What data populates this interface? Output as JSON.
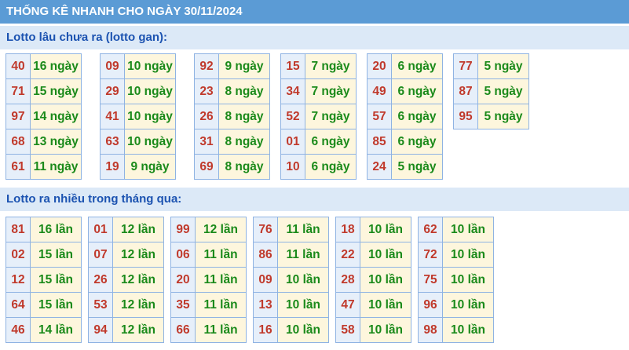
{
  "title": "THỐNG KÊ NHANH CHO NGÀY 30/11/2024",
  "gan": {
    "heading": "Lotto lâu chưa ra (lotto gan):",
    "columns": [
      [
        {
          "num": "40",
          "count": "16 ngày"
        },
        {
          "num": "71",
          "count": "15 ngày"
        },
        {
          "num": "97",
          "count": "14 ngày"
        },
        {
          "num": "68",
          "count": "13 ngày"
        },
        {
          "num": "61",
          "count": "11 ngày"
        }
      ],
      [
        {
          "num": "09",
          "count": "10 ngày"
        },
        {
          "num": "29",
          "count": "10 ngày"
        },
        {
          "num": "41",
          "count": "10 ngày"
        },
        {
          "num": "63",
          "count": "10 ngày"
        },
        {
          "num": "19",
          "count": "9 ngày"
        }
      ],
      [
        {
          "num": "92",
          "count": "9 ngày"
        },
        {
          "num": "23",
          "count": "8 ngày"
        },
        {
          "num": "26",
          "count": "8 ngày"
        },
        {
          "num": "31",
          "count": "8 ngày"
        },
        {
          "num": "69",
          "count": "8 ngày"
        }
      ],
      [
        {
          "num": "15",
          "count": "7 ngày"
        },
        {
          "num": "34",
          "count": "7 ngày"
        },
        {
          "num": "52",
          "count": "7 ngày"
        },
        {
          "num": "01",
          "count": "6 ngày"
        },
        {
          "num": "10",
          "count": "6 ngày"
        }
      ],
      [
        {
          "num": "20",
          "count": "6 ngày"
        },
        {
          "num": "49",
          "count": "6 ngày"
        },
        {
          "num": "57",
          "count": "6 ngày"
        },
        {
          "num": "85",
          "count": "6 ngày"
        },
        {
          "num": "24",
          "count": "5 ngày"
        }
      ],
      [
        {
          "num": "77",
          "count": "5 ngày"
        },
        {
          "num": "87",
          "count": "5 ngày"
        },
        {
          "num": "95",
          "count": "5 ngày"
        }
      ]
    ]
  },
  "nhieu": {
    "heading": "Lotto ra nhiều trong tháng qua:",
    "columns": [
      [
        {
          "num": "81",
          "count": "16 lần"
        },
        {
          "num": "02",
          "count": "15 lần"
        },
        {
          "num": "12",
          "count": "15 lần"
        },
        {
          "num": "64",
          "count": "15 lần"
        },
        {
          "num": "46",
          "count": "14 lần"
        }
      ],
      [
        {
          "num": "01",
          "count": "12 lần"
        },
        {
          "num": "07",
          "count": "12 lần"
        },
        {
          "num": "26",
          "count": "12 lần"
        },
        {
          "num": "53",
          "count": "12 lần"
        },
        {
          "num": "94",
          "count": "12 lần"
        }
      ],
      [
        {
          "num": "99",
          "count": "12 lần"
        },
        {
          "num": "06",
          "count": "11 lần"
        },
        {
          "num": "20",
          "count": "11 lần"
        },
        {
          "num": "35",
          "count": "11 lần"
        },
        {
          "num": "66",
          "count": "11 lần"
        }
      ],
      [
        {
          "num": "76",
          "count": "11 lần"
        },
        {
          "num": "86",
          "count": "11 lần"
        },
        {
          "num": "09",
          "count": "10 lần"
        },
        {
          "num": "13",
          "count": "10 lần"
        },
        {
          "num": "16",
          "count": "10 lần"
        }
      ],
      [
        {
          "num": "18",
          "count": "10 lần"
        },
        {
          "num": "22",
          "count": "10 lần"
        },
        {
          "num": "28",
          "count": "10 lần"
        },
        {
          "num": "47",
          "count": "10 lần"
        },
        {
          "num": "58",
          "count": "10 lần"
        }
      ],
      [
        {
          "num": "62",
          "count": "10 lần"
        },
        {
          "num": "72",
          "count": "10 lần"
        },
        {
          "num": "75",
          "count": "10 lần"
        },
        {
          "num": "96",
          "count": "10 lần"
        },
        {
          "num": "98",
          "count": "10 lần"
        }
      ]
    ]
  }
}
